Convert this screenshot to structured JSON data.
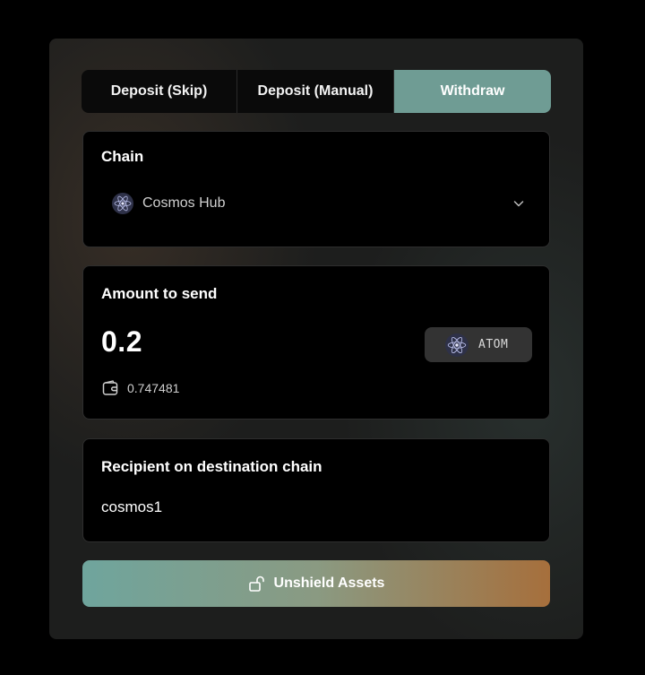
{
  "tabs": [
    {
      "label": "Deposit (Skip)",
      "active": false
    },
    {
      "label": "Deposit (Manual)",
      "active": false
    },
    {
      "label": "Withdraw",
      "active": true
    }
  ],
  "chain": {
    "title": "Chain",
    "selected": "Cosmos Hub",
    "icon": "cosmos-hub-logo-icon"
  },
  "amount": {
    "title": "Amount to send",
    "value": "0.2",
    "token_symbol": "ATOM",
    "balance": "0.747481",
    "balance_icon": "wallet-icon"
  },
  "recipient": {
    "title": "Recipient on destination chain",
    "value": "cosmos1"
  },
  "action": {
    "label": "Unshield Assets",
    "icon": "unlock-icon"
  },
  "colors": {
    "active_tab": "#6f9c94",
    "button_gradient_start": "#6fa59d",
    "button_gradient_end": "#a66f3c"
  }
}
